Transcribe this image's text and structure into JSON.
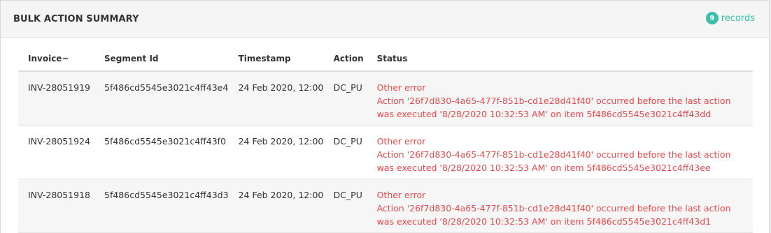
{
  "panel": {
    "title": "BULK ACTION SUMMARY",
    "records_count": "9",
    "records_label": "records"
  },
  "table": {
    "headers": [
      "Invoice~",
      "Segment Id",
      "Timestamp",
      "Action",
      "Status"
    ],
    "rows": [
      {
        "invoice": "INV-28051919",
        "segment_id": "5f486cd5545e3021c4ff43e4",
        "timestamp": "24 Feb 2020, 12:00",
        "action": "DC_PU",
        "status_title": "Other error",
        "status_detail": "Action '26f7d830-4a65-477f-851b-cd1e28d41f40' occurred before the last action was executed '8/28/2020 10:32:53 AM' on item 5f486cd5545e3021c4ff43dd"
      },
      {
        "invoice": "INV-28051924",
        "segment_id": "5f486cd5545e3021c4ff43f0",
        "timestamp": "24 Feb 2020, 12:00",
        "action": "DC_PU",
        "status_title": "Other error",
        "status_detail": "Action '26f7d830-4a65-477f-851b-cd1e28d41f40' occurred before the last action was executed '8/28/2020 10:32:53 AM' on item 5f486cd5545e3021c4ff43ee"
      },
      {
        "invoice": "INV-28051918",
        "segment_id": "5f486cd5545e3021c4ff43d3",
        "timestamp": "24 Feb 2020, 12:00",
        "action": "DC_PU",
        "status_title": "Other error",
        "status_detail": "Action '26f7d830-4a65-477f-851b-cd1e28d41f40' occurred before the last action was executed '8/28/2020 10:32:53 AM' on item 5f486cd5545e3021c4ff43d1"
      }
    ]
  },
  "colors": {
    "accent": "#3bbfa7",
    "error": "#e64b4b"
  }
}
